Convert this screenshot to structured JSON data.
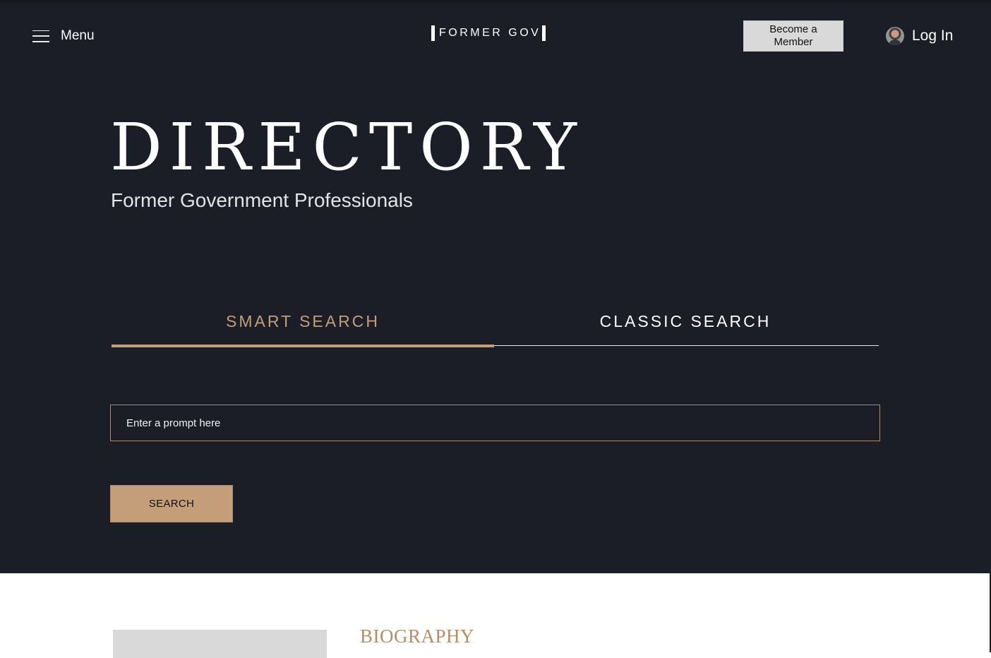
{
  "header": {
    "menu_label": "Menu",
    "logo_text": "FORMER GOV",
    "member_button": "Become a\nMember",
    "login_label": "Log In"
  },
  "hero": {
    "title": "DIRECTORY",
    "subtitle": "Former Government Professionals"
  },
  "tabs": [
    {
      "label": "SMART SEARCH",
      "active": true
    },
    {
      "label": "CLASSIC SEARCH",
      "active": false
    }
  ],
  "search": {
    "placeholder": "Enter a prompt here",
    "value": "",
    "button_label": "SEARCH"
  },
  "biography": {
    "heading": "BIOGRAPHY"
  },
  "colors": {
    "background": "#1b1e26",
    "accent": "#c49e78",
    "text": "#ffffff"
  },
  "icons": [
    "hamburger-menu-icon",
    "user-avatar"
  ]
}
